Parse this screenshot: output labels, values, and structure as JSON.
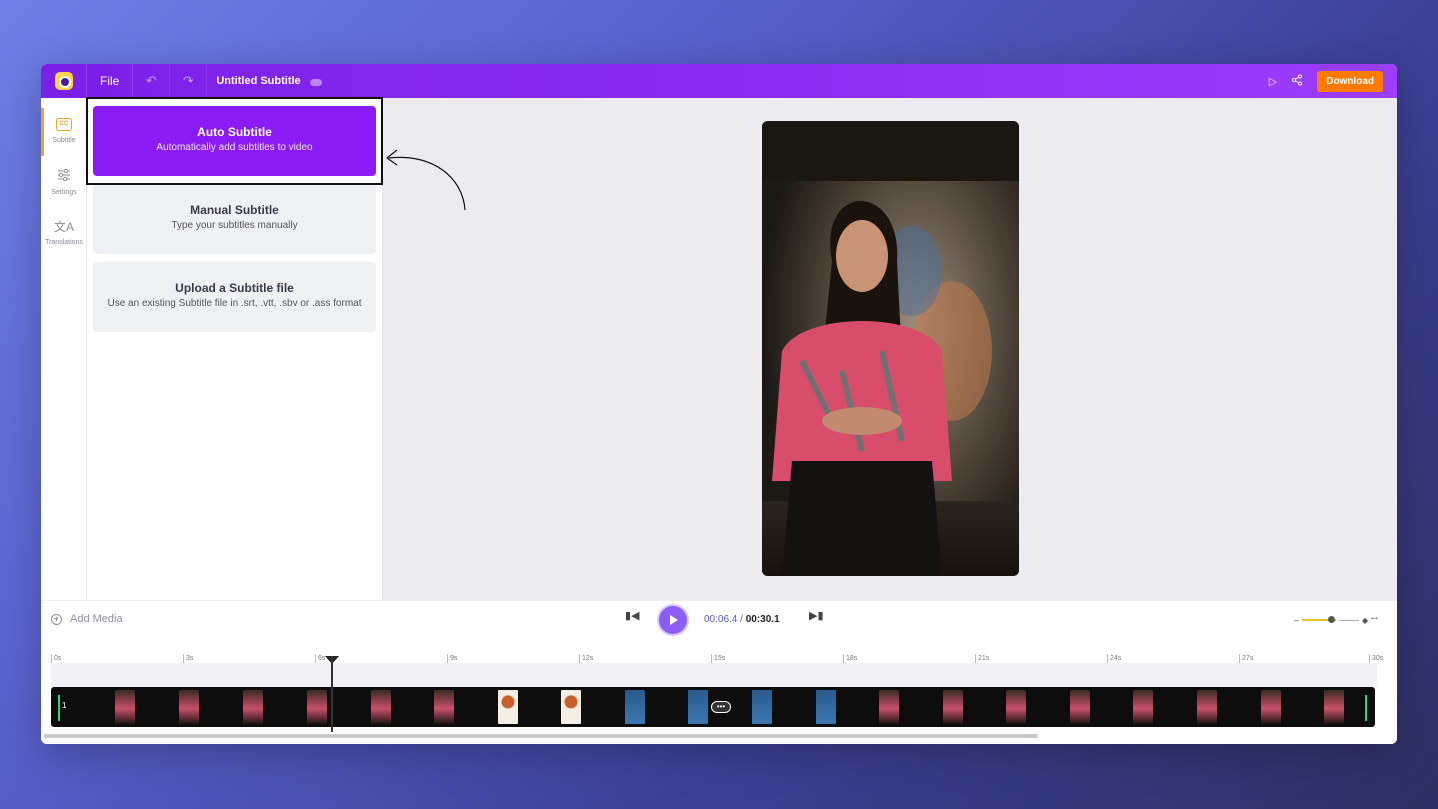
{
  "topbar": {
    "file_label": "File",
    "doc_title": "Untitled Subtitle",
    "download_label": "Download",
    "colors": {
      "bar": "#8a2cf2",
      "download": "#ff7a00"
    }
  },
  "rail": {
    "items": [
      {
        "label": "Subtitle",
        "icon": "cc-icon",
        "active": true
      },
      {
        "label": "Settings",
        "icon": "sliders-icon",
        "active": false
      },
      {
        "label": "Translations",
        "icon": "translate-icon",
        "active": false
      }
    ]
  },
  "panel": {
    "options": [
      {
        "title": "Auto Subtitle",
        "desc": "Automatically add subtitles to video",
        "active": true
      },
      {
        "title": "Manual Subtitle",
        "desc": "Type your subtitles manually",
        "active": false
      },
      {
        "title": "Upload a Subtitle file",
        "desc": "Use an existing Subtitle file in .srt, .vtt, .sbv or .ass format",
        "active": false
      }
    ]
  },
  "player": {
    "add_media": "Add Media",
    "current_time": "00:06.4",
    "separator": " / ",
    "total_time": "00:30.1"
  },
  "timeline": {
    "ticks": [
      "0s",
      "3s",
      "6s",
      "9s",
      "12s",
      "15s",
      "18s",
      "21s",
      "24s",
      "27s",
      "30s"
    ],
    "track_number": "1"
  }
}
